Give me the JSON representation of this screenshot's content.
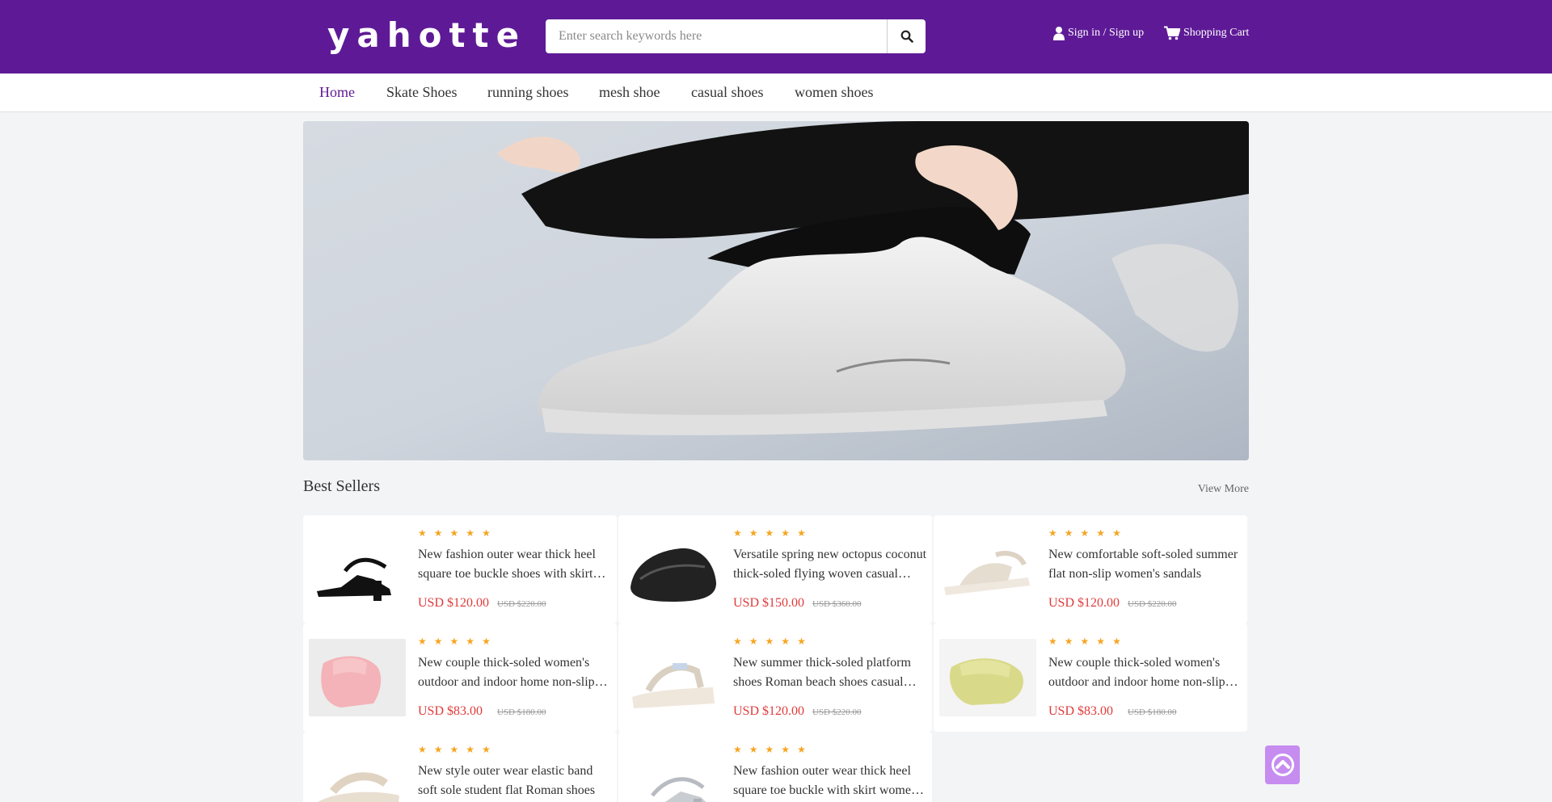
{
  "header": {
    "logo": "yahotte",
    "search_placeholder": "Enter search keywords here",
    "search_icon": "search-icon",
    "sign_in_label": "Sign in / Sign up",
    "cart_label": "Shopping Cart",
    "brand_color": "#5e1a96"
  },
  "nav": {
    "items": [
      "Home",
      "Skate Shoes",
      "running shoes",
      "mesh shoe",
      "casual shoes",
      "women shoes"
    ],
    "active": "Home"
  },
  "best_sellers": {
    "title": "Best Sellers",
    "view_more": "View More",
    "products": [
      {
        "title": "New fashion outer wear thick heel square toe buckle shoes with skirt women's sandals",
        "price": "USD $120.00",
        "old_price": "USD $220.00",
        "rating": 5
      },
      {
        "title": "Versatile spring new octopus coconut thick-soled flying woven casual shoes",
        "price": "USD $150.00",
        "old_price": "USD $360.00",
        "rating": 5
      },
      {
        "title": "New comfortable soft-soled summer flat non-slip women's sandals",
        "price": "USD $120.00",
        "old_price": "USD $220.00",
        "rating": 5
      },
      {
        "title": "New couple thick-soled women's outdoor and indoor home non-slip sandals",
        "price": "USD $83.00",
        "old_price": "USD $180.00",
        "rating": 5
      },
      {
        "title": "New summer thick-soled platform shoes Roman beach shoes casual women sandals",
        "price": "USD $120.00",
        "old_price": "USD $220.00",
        "rating": 5
      },
      {
        "title": "New couple thick-soled women's outdoor and indoor home non-slip sandals",
        "price": "USD $83.00",
        "old_price": "USD $180.00",
        "rating": 5
      },
      {
        "title": "New style outer wear elastic band soft sole student flat Roman shoes",
        "price": "",
        "old_price": "",
        "rating": 5
      },
      {
        "title": "New fashion outer wear thick heel square toe buckle with skirt women's sandals",
        "price": "",
        "old_price": "",
        "rating": 5
      }
    ]
  },
  "back_to_top_icon": "back-to-top-icon"
}
